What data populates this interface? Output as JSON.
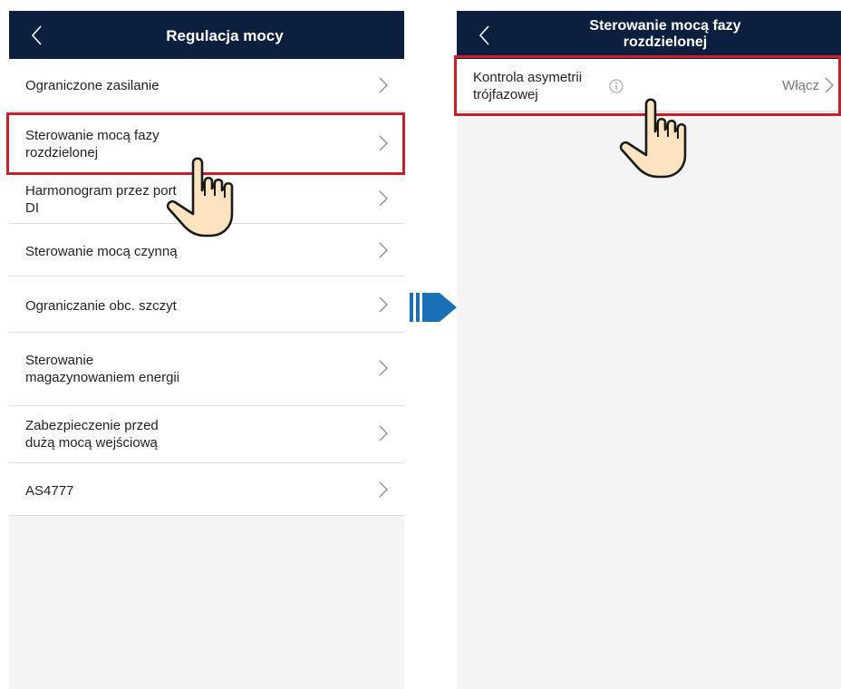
{
  "left_screen": {
    "header": {
      "title": "Regulacja mocy"
    },
    "items": [
      {
        "lines": [
          "Ograniczone zasilanie"
        ]
      },
      {
        "lines": [
          "Sterowanie mocą fazy",
          "rozdzielonej"
        ]
      },
      {
        "lines": [
          "Harmonogram przez port",
          "DI"
        ]
      },
      {
        "lines": [
          "Sterowanie mocą czynną"
        ]
      },
      {
        "lines": [
          "Ograniczanie obc. szczyt"
        ]
      },
      {
        "lines": [
          "Sterowanie",
          "magazynowaniem energii"
        ]
      },
      {
        "lines": [
          "Zabezpieczenie przed",
          "dużą mocą wejściową"
        ]
      },
      {
        "lines": [
          "AS4777"
        ]
      }
    ]
  },
  "right_screen": {
    "header": {
      "title_lines": [
        "Sterowanie mocą fazy",
        "rozdzielonej"
      ]
    },
    "item": {
      "lines": [
        "Kontrola asymetrii",
        "trójfazowej"
      ],
      "value": "Włącz"
    }
  },
  "colors": {
    "header_bg": "#0d1f3f",
    "highlight": "#c8202b",
    "arrow": "#1a6fb5",
    "hand_fill": "#fde3c0"
  },
  "icons": [
    "back-chevron-icon",
    "chevron-right-icon",
    "info-icon",
    "pointing-hand-icon",
    "transition-arrow-icon"
  ]
}
